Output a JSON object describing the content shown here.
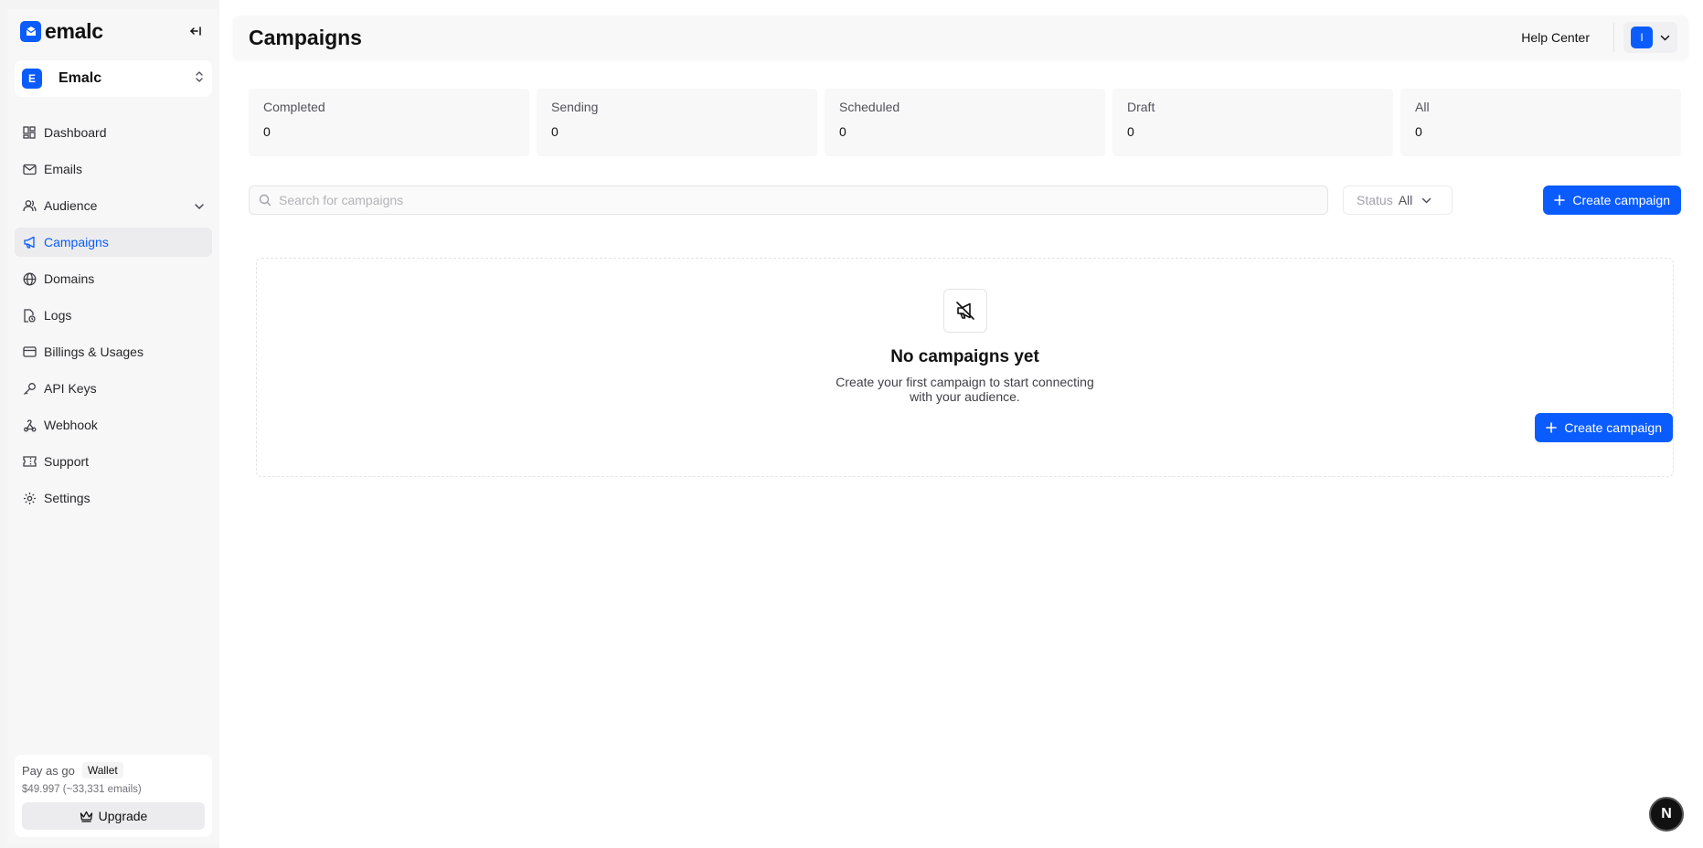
{
  "brand": {
    "name": "emalc"
  },
  "workspace": {
    "initial": "E",
    "name": "Emalc"
  },
  "nav": {
    "dashboard": "Dashboard",
    "emails": "Emails",
    "audience": "Audience",
    "campaigns": "Campaigns",
    "domains": "Domains",
    "logs": "Logs",
    "billings": "Billings & Usages",
    "api_keys": "API Keys",
    "webhook": "Webhook",
    "support": "Support",
    "settings": "Settings"
  },
  "plan": {
    "name": "Pay as go",
    "badge": "Wallet",
    "balance": "$49.997 (~33,331 emails)",
    "upgrade_label": "Upgrade"
  },
  "header": {
    "title": "Campaigns",
    "help_center": "Help Center",
    "user_initial": "I"
  },
  "stats": [
    {
      "label": "Completed",
      "value": "0"
    },
    {
      "label": "Sending",
      "value": "0"
    },
    {
      "label": "Scheduled",
      "value": "0"
    },
    {
      "label": "Draft",
      "value": "0"
    },
    {
      "label": "All",
      "value": "0"
    }
  ],
  "toolbar": {
    "search_placeholder": "Search for campaigns",
    "status_label": "Status",
    "status_value": "All",
    "create_label": "Create campaign"
  },
  "empty_state": {
    "title": "No campaigns yet",
    "description": "Create your first campaign to start connecting with your audience.",
    "create_label": "Create campaign"
  },
  "dev_badge": "N",
  "colors": {
    "accent": "#0b5cff"
  }
}
